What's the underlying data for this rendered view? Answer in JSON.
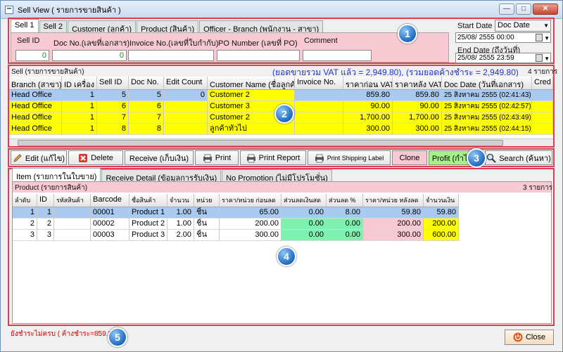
{
  "window": {
    "title": "Sell View ( รายการขายสินค้า )"
  },
  "top_tabs": [
    "Sell 1",
    "Sell 2",
    "Customer (ลูกค้า)",
    "Product (สินค้า)",
    "Officer - Branch (พนักงาน - สาขา)"
  ],
  "filters": {
    "sell_id_label": "Sell ID",
    "sell_id_value": "0",
    "doc_no_label": "Doc No.(เลขที่เอกสาร)",
    "doc_no_value": "0",
    "invoice_label": "Invoice No.(เลขที่ใบกำกับ)",
    "invoice_value": "",
    "po_label": "PO Number (เลขที่ PO)",
    "po_value": "",
    "comment_label": "Comment",
    "comment_value": "",
    "start_date_label": "Start Date",
    "start_date_value": "25/08/  2555 00:00",
    "end_date_label": "End Date (ถึงวันที่)",
    "end_date_value": "25/08/  2555 23:59",
    "date_type_value": "Doc Date"
  },
  "badges": [
    "1",
    "2",
    "3",
    "4",
    "5"
  ],
  "sell_grid": {
    "caption": "Sell (รายการขายสินค้า)",
    "summary": "(ยอดขายรวม VAT แล้ว = 2,949.80), (รวมยอดค้างชำระ = 2,949.80)",
    "count": "4 รายการ",
    "columns": [
      "Branch (สาขา)",
      "ID เครื่อง",
      "Sell ID",
      "Doc No.",
      "Edit Count",
      "Customer Name (ชื่อลูกค้า)",
      "Invoice No.",
      "ราคาก่อน VAT",
      "ราคาหลัง VAT",
      "Doc Date (วันที่เอกสาร)",
      "Cred"
    ],
    "rows": [
      [
        "Head Office",
        "1",
        "5",
        "5",
        "0",
        "Customer 2",
        "",
        "859.80",
        "859.80",
        "25 สิงหาคม 2555 (02:41:43)",
        ""
      ],
      [
        "Head Office",
        "1",
        "6",
        "6",
        "",
        "Customer 3",
        "",
        "90.00",
        "90.00",
        "25 สิงหาคม 2555 (02:42:57)",
        ""
      ],
      [
        "Head Office",
        "1",
        "7",
        "7",
        "",
        "Customer 2",
        "",
        "1,700.00",
        "1,700.00",
        "25 สิงหาคม 2555 (02:43:49)",
        ""
      ],
      [
        "Head Office",
        "1",
        "8",
        "8",
        "",
        "ลูกค้าทั่วไป",
        "",
        "300.00",
        "300.00",
        "25 สิงหาคม 2555 (02:44:15)",
        ""
      ]
    ]
  },
  "toolbar": {
    "edit": "Edit (แก้ไข)",
    "delete": "Delete",
    "receive": "Receive (เก็บเงิน)",
    "print": "Print",
    "print_report": "Print Report",
    "print_label": "Print Shipping Label",
    "clone": "Clone",
    "profit": "Profit (กำไร)",
    "search": "Search (ค้นหา)"
  },
  "bottom_tabs": [
    "Item (รายการในใบขาย)",
    "Receive Detail (ข้อมูลการรับเงิน)",
    "No Promotion (ไม่มีโปรโมชั่น)"
  ],
  "item_grid": {
    "caption": "Product (รายการสินค้า)",
    "count": "3 รายการ",
    "columns": [
      "ลำดับ",
      "ID",
      "รหัสสินค้า",
      "Barcode",
      "ชื่อสินค้า",
      "จำนวน",
      "หน่วย",
      "ราคา/หน่วย ก่อนลด",
      "ส่วนลดเงินสด",
      "ส่วนลด %",
      "ราคา/หน่วย หลังลด",
      "จำนวนเงิน"
    ],
    "rows": [
      [
        "1",
        "1",
        "",
        "00001",
        "Product 1",
        "1.00",
        "ชิ้น",
        "65.00",
        "0.00",
        "8.00",
        "59.80",
        "59.80"
      ],
      [
        "2",
        "2",
        "",
        "00002",
        "Product 2",
        "1.00",
        "ชิ้น",
        "200.00",
        "0.00",
        "0.00",
        "200.00",
        "200.00"
      ],
      [
        "3",
        "3",
        "",
        "00003",
        "Product 3",
        "2.00",
        "ชิ้น",
        "300.00",
        "0.00",
        "0.00",
        "300.00",
        "600.00"
      ]
    ]
  },
  "status": {
    "text": "ยังชำระไม่ครบ ( ค้างชำระ=859.80 )"
  },
  "close_label": "Close"
}
